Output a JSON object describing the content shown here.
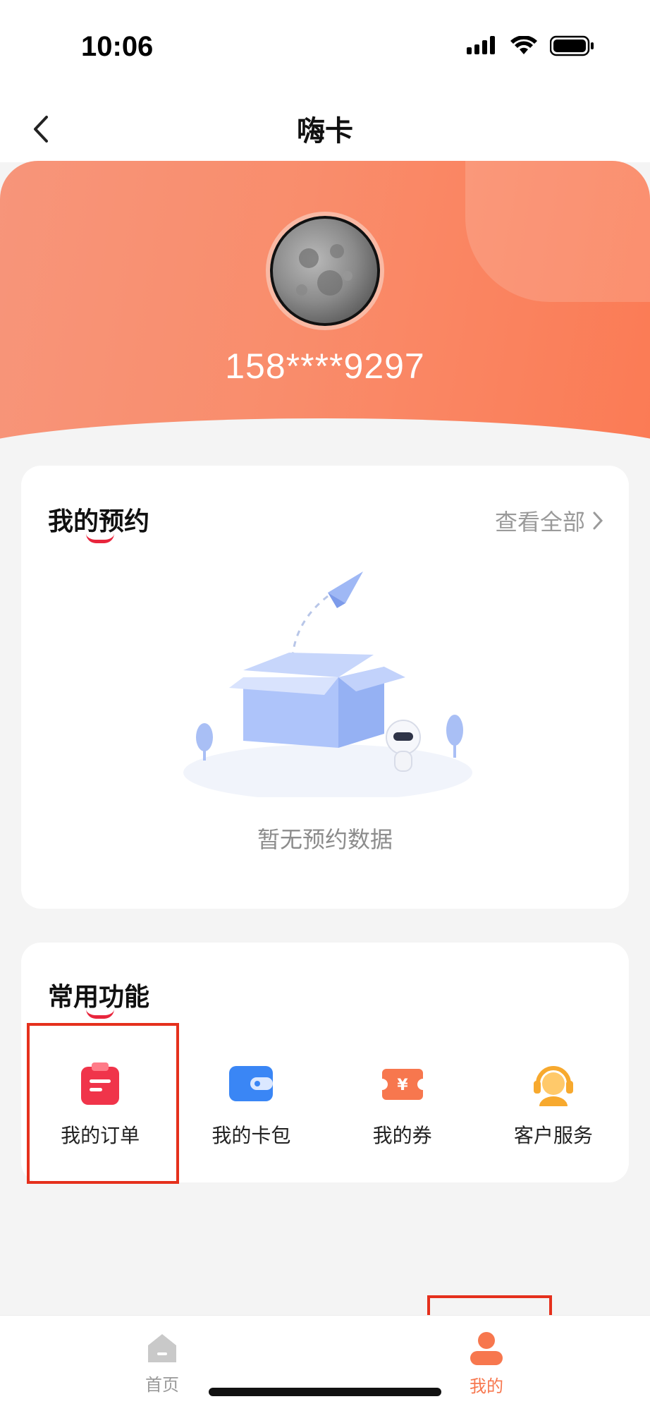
{
  "status": {
    "time": "10:06"
  },
  "nav": {
    "title": "嗨卡"
  },
  "profile": {
    "phone": "158****9297"
  },
  "booking": {
    "title": "我的预约",
    "view_all": "查看全部",
    "empty_text": "暂无预约数据"
  },
  "functions": {
    "title": "常用功能",
    "items": [
      {
        "label": "我的订单",
        "icon": "clipboard-icon",
        "color": "#f0344a"
      },
      {
        "label": "我的卡包",
        "icon": "wallet-icon",
        "color": "#3a86f5"
      },
      {
        "label": "我的券",
        "icon": "coupon-icon",
        "color": "#f7774e"
      },
      {
        "label": "客户服务",
        "icon": "headset-icon",
        "color": "#f7a92e"
      }
    ]
  },
  "tabbar": {
    "items": [
      {
        "label": "首页",
        "icon": "home-icon",
        "active": false
      },
      {
        "label": "我的",
        "icon": "user-icon",
        "active": true
      }
    ],
    "active_color": "#f7774e",
    "inactive_color": "#9a9a9a"
  },
  "colors": {
    "accent": "#f98d6c",
    "highlight": "#e5301c"
  }
}
